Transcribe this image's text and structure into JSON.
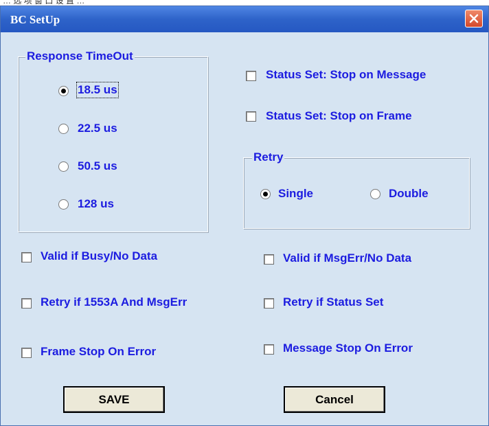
{
  "window": {
    "title": "BC SetUp"
  },
  "background_text": "… 选 项 窗 口 设 置 …",
  "response_timeout": {
    "legend": "Response TimeOut",
    "options": [
      {
        "label": "18.5 us",
        "selected": true
      },
      {
        "label": "22.5 us",
        "selected": false
      },
      {
        "label": "50.5 us",
        "selected": false
      },
      {
        "label": "128 us",
        "selected": false
      }
    ]
  },
  "status": {
    "stop_on_message": {
      "label": "Status  Set: Stop on Message",
      "checked": false
    },
    "stop_on_frame": {
      "label": "Status  Set: Stop on Frame",
      "checked": false
    }
  },
  "retry": {
    "legend": "Retry",
    "options": [
      {
        "label": "Single",
        "selected": true
      },
      {
        "label": "Double",
        "selected": false
      }
    ]
  },
  "options": {
    "valid_busy": {
      "label": "Valid if Busy/No Data",
      "checked": false
    },
    "valid_msgerr": {
      "label": "Valid if MsgErr/No Data",
      "checked": false
    },
    "retry_1553a": {
      "label": "Retry if 1553A And  MsgErr",
      "checked": false
    },
    "retry_status": {
      "label": "Retry  if  Status Set",
      "checked": false
    },
    "frame_stop": {
      "label": "Frame Stop On Error",
      "checked": false
    },
    "message_stop": {
      "label": "Message Stop On Error",
      "checked": false
    }
  },
  "buttons": {
    "save": "SAVE",
    "cancel": "Cancel"
  },
  "colors": {
    "label": "#1c1ce0",
    "dialog_bg": "#d6e4f2",
    "titlebar": "#2e63c9"
  }
}
